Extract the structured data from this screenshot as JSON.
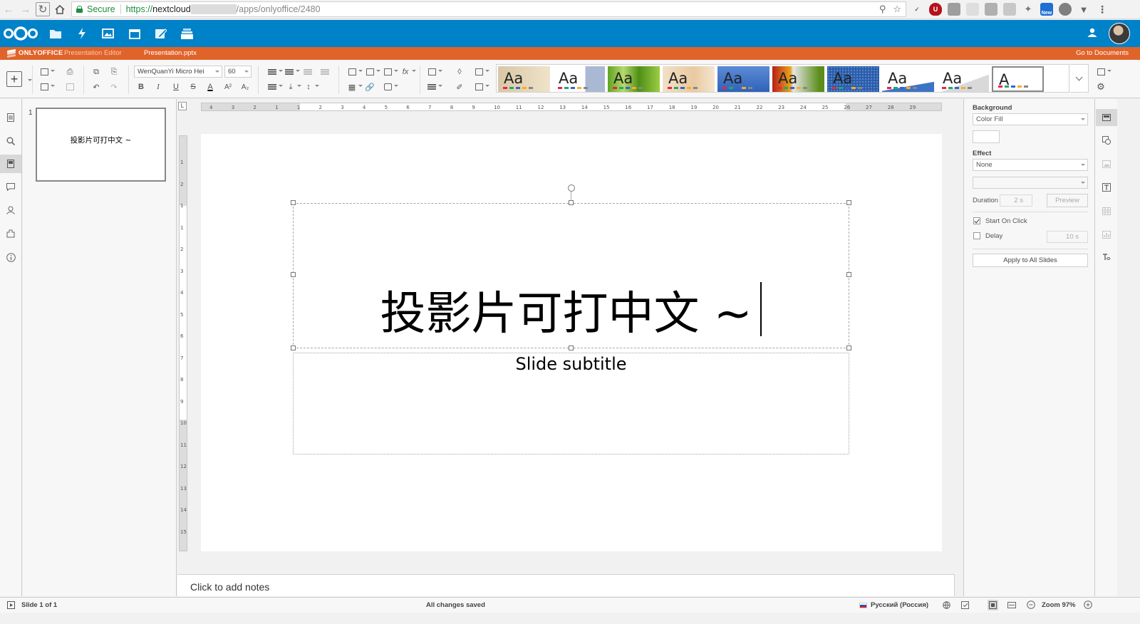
{
  "browser": {
    "secure_label": "Secure",
    "url_scheme": "https://",
    "url_host": "nextcloud",
    "url_path": "/apps/onlyoffice/2480",
    "ext_new_badge": "New"
  },
  "nextcloud": {
    "apps": [
      "files-icon",
      "activity-icon",
      "gallery-icon",
      "calendar-icon",
      "notes-icon",
      "deck-icon"
    ]
  },
  "onlyoffice": {
    "brand": "ONLYOFFICE",
    "editor_name": "Presentation Editor",
    "file_name": "Presentation.pptx",
    "go_to_documents": "Go to Documents"
  },
  "toolbar": {
    "font_name": "WenQuanYi Micro Hei",
    "font_size": "60",
    "bold": "B",
    "italic": "I",
    "underline": "U",
    "strike": "S",
    "font_color": "A",
    "superscript": "A²",
    "subscript": "A₂",
    "themes": [
      {
        "label": "Aa",
        "bg": "linear-gradient(90deg,#d9c7a6,#efe3c9)"
      },
      {
        "label": "Aa",
        "bg": "linear-gradient(90deg,#ffffff 0 62%,#a9b9d4 62%)"
      },
      {
        "label": "Aa",
        "bg": "linear-gradient(90deg,#5fa31f,#b7d96d 30%,#4f8f16 60%,#9ccd45)"
      },
      {
        "label": "Aa",
        "bg": "linear-gradient(90deg,#f1e1c8,#e9caa0 60%,#f3e5d0)"
      },
      {
        "label": "Aa",
        "bg": "linear-gradient(180deg,#5c8bd6,#2f63b9)"
      },
      {
        "label": "Aa",
        "bg": "linear-gradient(90deg,#b61f17,#e9a41c 35%,#e7e7e7 40%,#5b8e1b 90%)"
      },
      {
        "label": "Aa",
        "bg": "radial-gradient(circle,#4e86d6 0 1px,#2c5aa3 1.5px) 0 0/4px 4px"
      },
      {
        "label": "Aa",
        "bg": "linear-gradient(170deg,#ffffff 0 70%,#3c73c5 72%)"
      },
      {
        "label": "Aa",
        "bg": "linear-gradient(160deg,#ffffff 0 60%,#d9d9d9 62%)"
      },
      {
        "label": "A",
        "bg": "#ffffff"
      }
    ]
  },
  "slides_panel": {
    "number": "1",
    "thumb_text": "投影片可打中文 ~"
  },
  "slide": {
    "title": "投影片可打中文 ~",
    "subtitle": "Slide subtitle"
  },
  "ruler": {
    "h_ticks": [
      "4",
      "3",
      "2",
      "1",
      "1",
      "2",
      "3",
      "4",
      "5",
      "6",
      "7",
      "8",
      "9",
      "10",
      "11",
      "12",
      "13",
      "14",
      "15",
      "16",
      "17",
      "18",
      "19",
      "20",
      "21",
      "22",
      "23",
      "24",
      "25",
      "26",
      "27",
      "28",
      "29"
    ],
    "v_ticks": [
      "1",
      "2",
      "1",
      "1",
      "2",
      "3",
      "4",
      "5",
      "6",
      "7",
      "8",
      "9",
      "10",
      "11",
      "12",
      "13",
      "14",
      "15"
    ]
  },
  "notes": {
    "placeholder": "Click to add notes"
  },
  "right_panel": {
    "background_label": "Background",
    "fill_value": "Color Fill",
    "effect_label": "Effect",
    "effect_value": "None",
    "duration_label": "Duration",
    "duration_value": "2 s",
    "preview_label": "Preview",
    "start_on_click_label": "Start On Click",
    "start_on_click_checked": true,
    "delay_label": "Delay",
    "delay_checked": false,
    "delay_value": "10 s",
    "apply_all_label": "Apply to All Slides"
  },
  "status": {
    "slide_of": "Slide 1 of 1",
    "save_state": "All changes saved",
    "language": "Русский (Россия)",
    "zoom": "Zoom 97%"
  },
  "colors": {
    "nextcloud_blue": "#0082c9",
    "onlyoffice_orange": "#e0632a",
    "secure_green": "#1e8e3e"
  }
}
